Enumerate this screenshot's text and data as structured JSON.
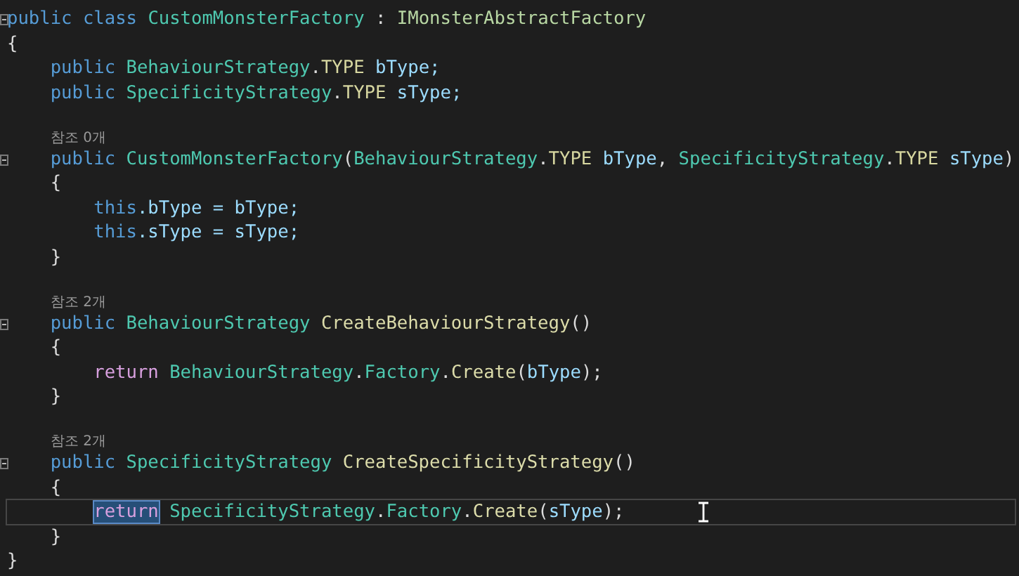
{
  "editor": {
    "lines": [
      {
        "kind": "code",
        "fold": true,
        "current": false,
        "tokens": [
          {
            "t": "public",
            "kind": "kw"
          },
          {
            "t": " class ",
            "kind": "kw"
          },
          {
            "t": "CustomMonsterFactory",
            "kind": "type"
          },
          {
            "t": " : ",
            "kind": "plain"
          },
          {
            "t": "IMonsterAbstractFactory",
            "kind": "iface"
          }
        ]
      },
      {
        "kind": "code",
        "fold": false,
        "current": false,
        "tokens": [
          {
            "t": "{",
            "kind": "plain"
          }
        ]
      },
      {
        "kind": "code",
        "fold": false,
        "current": false,
        "tokens": [
          {
            "t": "    public ",
            "kind": "kw"
          },
          {
            "t": "BehaviourStrategy",
            "kind": "type"
          },
          {
            "t": ".",
            "kind": "plain"
          },
          {
            "t": "TYPE",
            "kind": "enum"
          },
          {
            "t": " bType;",
            "kind": "field"
          }
        ]
      },
      {
        "kind": "code",
        "fold": false,
        "current": false,
        "tokens": [
          {
            "t": "    public ",
            "kind": "kw"
          },
          {
            "t": "SpecificityStrategy",
            "kind": "type"
          },
          {
            "t": ".",
            "kind": "plain"
          },
          {
            "t": "TYPE",
            "kind": "enum"
          },
          {
            "t": " sType;",
            "kind": "field"
          }
        ]
      },
      {
        "kind": "blank"
      },
      {
        "kind": "lens",
        "text": "참조 0개"
      },
      {
        "kind": "code",
        "fold": true,
        "current": false,
        "tokens": [
          {
            "t": "    public ",
            "kind": "kw"
          },
          {
            "t": "CustomMonsterFactory",
            "kind": "type"
          },
          {
            "t": "(",
            "kind": "plain"
          },
          {
            "t": "BehaviourStrategy",
            "kind": "type"
          },
          {
            "t": ".",
            "kind": "plain"
          },
          {
            "t": "TYPE",
            "kind": "enum"
          },
          {
            "t": " bType",
            "kind": "field"
          },
          {
            "t": ", ",
            "kind": "plain"
          },
          {
            "t": "SpecificityStrategy",
            "kind": "type"
          },
          {
            "t": ".",
            "kind": "plain"
          },
          {
            "t": "TYPE",
            "kind": "enum"
          },
          {
            "t": " sType",
            "kind": "field"
          },
          {
            "t": ")",
            "kind": "plain"
          }
        ]
      },
      {
        "kind": "code",
        "fold": false,
        "current": false,
        "tokens": [
          {
            "t": "    {",
            "kind": "plain"
          }
        ]
      },
      {
        "kind": "code",
        "fold": false,
        "current": false,
        "tokens": [
          {
            "t": "        this",
            "kind": "kw"
          },
          {
            "t": ".bType = bType;",
            "kind": "field"
          }
        ]
      },
      {
        "kind": "code",
        "fold": false,
        "current": false,
        "tokens": [
          {
            "t": "        this",
            "kind": "kw"
          },
          {
            "t": ".sType = sType;",
            "kind": "field"
          }
        ]
      },
      {
        "kind": "code",
        "fold": false,
        "current": false,
        "tokens": [
          {
            "t": "    }",
            "kind": "plain"
          }
        ]
      },
      {
        "kind": "blank"
      },
      {
        "kind": "lens",
        "text": "참조 2개"
      },
      {
        "kind": "code",
        "fold": true,
        "current": false,
        "tokens": [
          {
            "t": "    public ",
            "kind": "kw"
          },
          {
            "t": "BehaviourStrategy",
            "kind": "type"
          },
          {
            "t": " CreateBehaviourStrategy",
            "kind": "method"
          },
          {
            "t": "()",
            "kind": "plain"
          }
        ]
      },
      {
        "kind": "code",
        "fold": false,
        "current": false,
        "tokens": [
          {
            "t": "    {",
            "kind": "plain"
          }
        ]
      },
      {
        "kind": "code",
        "fold": false,
        "current": false,
        "tokens": [
          {
            "t": "        return",
            "kind": "ctrl"
          },
          {
            "t": " BehaviourStrategy",
            "kind": "type"
          },
          {
            "t": ".",
            "kind": "plain"
          },
          {
            "t": "Factory",
            "kind": "type"
          },
          {
            "t": ".",
            "kind": "plain"
          },
          {
            "t": "Create",
            "kind": "method"
          },
          {
            "t": "(",
            "kind": "plain"
          },
          {
            "t": "bType",
            "kind": "field"
          },
          {
            "t": ");",
            "kind": "plain"
          }
        ]
      },
      {
        "kind": "code",
        "fold": false,
        "current": false,
        "tokens": [
          {
            "t": "    }",
            "kind": "plain"
          }
        ]
      },
      {
        "kind": "blank"
      },
      {
        "kind": "lens",
        "text": "참조 2개"
      },
      {
        "kind": "code",
        "fold": true,
        "current": false,
        "tokens": [
          {
            "t": "    public ",
            "kind": "kw"
          },
          {
            "t": "SpecificityStrategy",
            "kind": "type"
          },
          {
            "t": " CreateSpecificityStrategy",
            "kind": "method"
          },
          {
            "t": "()",
            "kind": "plain"
          }
        ]
      },
      {
        "kind": "code",
        "fold": false,
        "current": false,
        "tokens": [
          {
            "t": "    {",
            "kind": "plain"
          }
        ]
      },
      {
        "kind": "code",
        "fold": false,
        "current": true,
        "tokens": [
          {
            "t": "        return",
            "kind": "ctrl",
            "selected": true
          },
          {
            "t": " SpecificityStrategy",
            "kind": "type"
          },
          {
            "t": ".",
            "kind": "plain"
          },
          {
            "t": "Factory",
            "kind": "type"
          },
          {
            "t": ".",
            "kind": "plain"
          },
          {
            "t": "Create",
            "kind": "method"
          },
          {
            "t": "(",
            "kind": "plain"
          },
          {
            "t": "sType",
            "kind": "field"
          },
          {
            "t": ");",
            "kind": "plain"
          }
        ]
      },
      {
        "kind": "code",
        "fold": false,
        "current": false,
        "tokens": [
          {
            "t": "    }",
            "kind": "plain"
          }
        ]
      },
      {
        "kind": "code",
        "fold": false,
        "current": false,
        "tokens": [
          {
            "t": "}",
            "kind": "plain"
          }
        ]
      }
    ]
  }
}
